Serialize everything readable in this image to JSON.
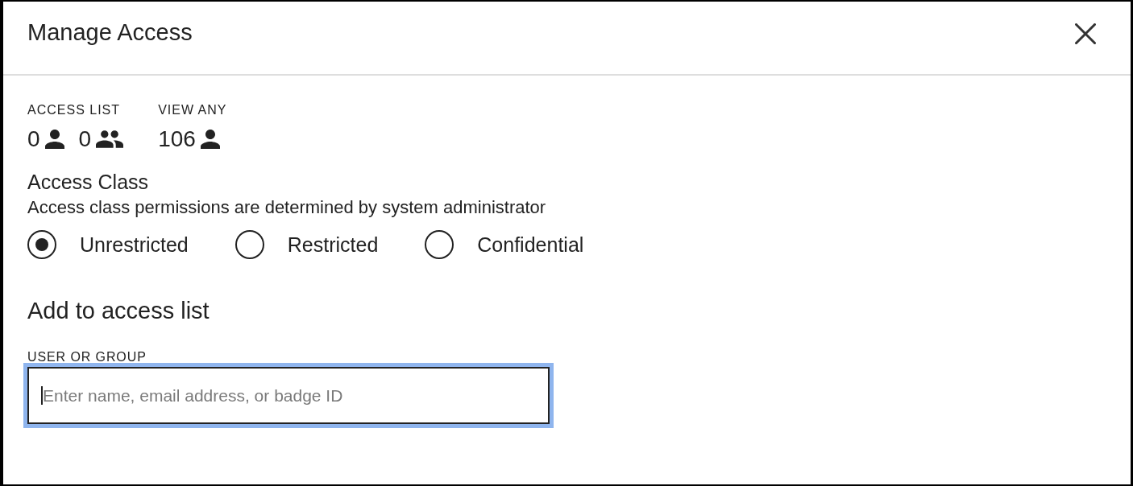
{
  "dialog": {
    "title": "Manage Access"
  },
  "summary": [
    {
      "label": "ACCESS LIST",
      "counts": [
        {
          "value": "0",
          "kind": "user"
        },
        {
          "value": "0",
          "kind": "group"
        }
      ]
    },
    {
      "label": "VIEW ANY",
      "counts": [
        {
          "value": "106",
          "kind": "user"
        }
      ]
    }
  ],
  "access_class": {
    "title": "Access Class",
    "description": "Access class permissions are determined by system administrator",
    "options": [
      {
        "label": "Unrestricted",
        "selected": true
      },
      {
        "label": "Restricted",
        "selected": false
      },
      {
        "label": "Confidential",
        "selected": false
      }
    ]
  },
  "add_section": {
    "title": "Add to access list",
    "field": {
      "label": "USER OR GROUP",
      "placeholder": "Enter name, email address, or badge ID",
      "focused": true
    }
  }
}
